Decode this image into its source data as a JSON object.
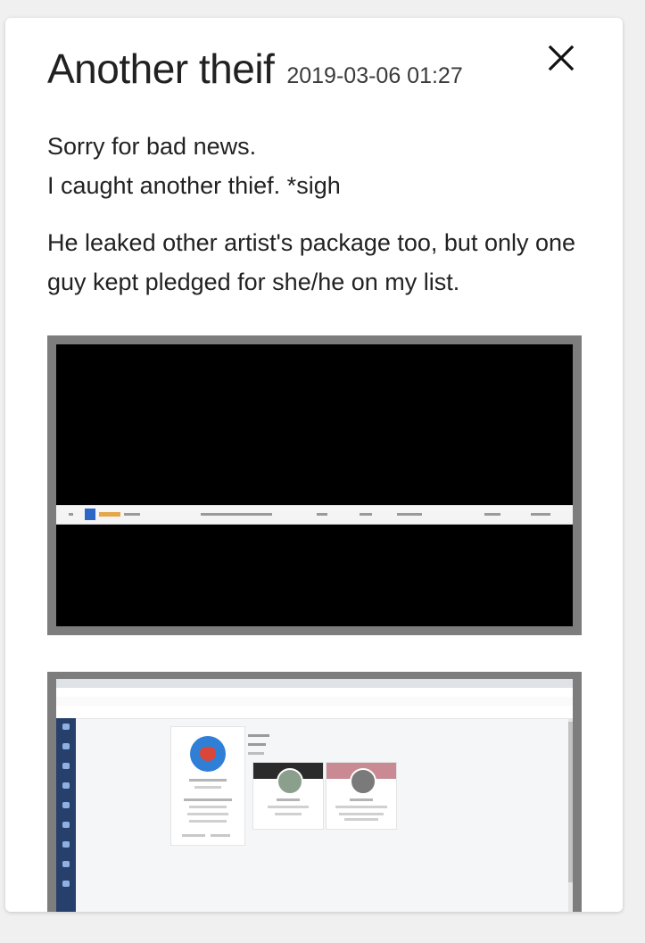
{
  "post": {
    "title": "Another theif",
    "timestamp": "2019-03-06 01:27",
    "paragraphs": [
      "Sorry for bad news.\nI caught another thief. *sigh",
      "He leaked other artist's package too, but only one guy kept pledged for she/he on my list."
    ]
  },
  "icons": {
    "close": "close-icon"
  },
  "colors": {
    "card_bg": "#ffffff",
    "frame_gray": "#7d7d7d",
    "text": "#222222",
    "sidebar_blue": "#26406b"
  }
}
